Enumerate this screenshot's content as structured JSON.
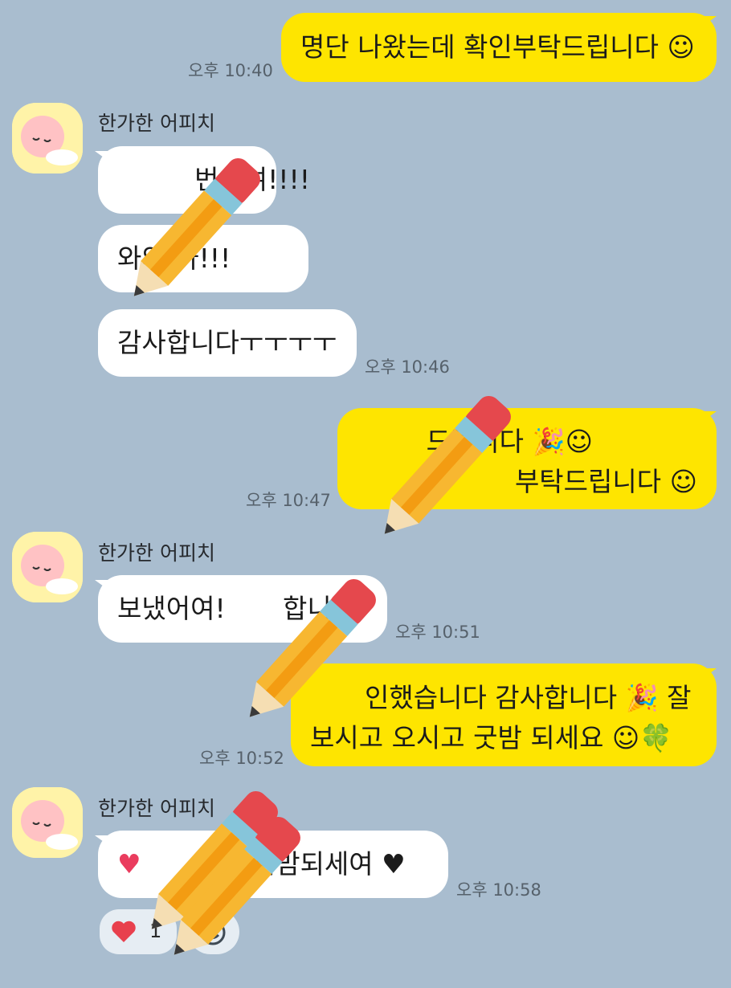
{
  "colors": {
    "background": "#a9bdcf",
    "my_bubble": "#fee500",
    "their_bubble": "#ffffff",
    "time": "#56616b"
  },
  "contact": {
    "name": "한가한 어피치",
    "avatar_icon": "apeach-avatar-icon"
  },
  "messages": [
    {
      "sender": "me",
      "lines": [
        "명단 나왔는데 확인부탁드립니다 ☺"
      ],
      "time": "오후 10:40"
    },
    {
      "sender": "them",
      "lines": [
        "번이여!!!!"
      ]
    },
    {
      "sender": "them",
      "lines": [
        "와와 아!!!"
      ]
    },
    {
      "sender": "them",
      "lines": [
        "감사합니다ㅜㅜㅜㅜ"
      ],
      "time": "오후 10:46"
    },
    {
      "sender": "me",
      "lines": [
        "드립니다 🎉☺",
        "부탁드립니다 ☺"
      ],
      "time": "오후 10:47"
    },
    {
      "sender": "them",
      "lines": [
        "보냈어여!",
        "합니다!"
      ],
      "time": "오후 10:51"
    },
    {
      "sender": "me",
      "lines": [
        "인했습니다 감사합니다 🎉 잘",
        "보시고 오시고 굿밤 되세요 ☺🍀"
      ],
      "time": "오후 10:52"
    },
    {
      "sender": "them",
      "lines": [
        "♥",
        "두 굿밤되세여 ♥"
      ],
      "time": "오후 10:58"
    }
  ],
  "reaction": {
    "icon": "heart-icon",
    "count": "1",
    "add_icon": "add-reaction-icon"
  },
  "overlay_icon": "pencil-sticker-icon"
}
